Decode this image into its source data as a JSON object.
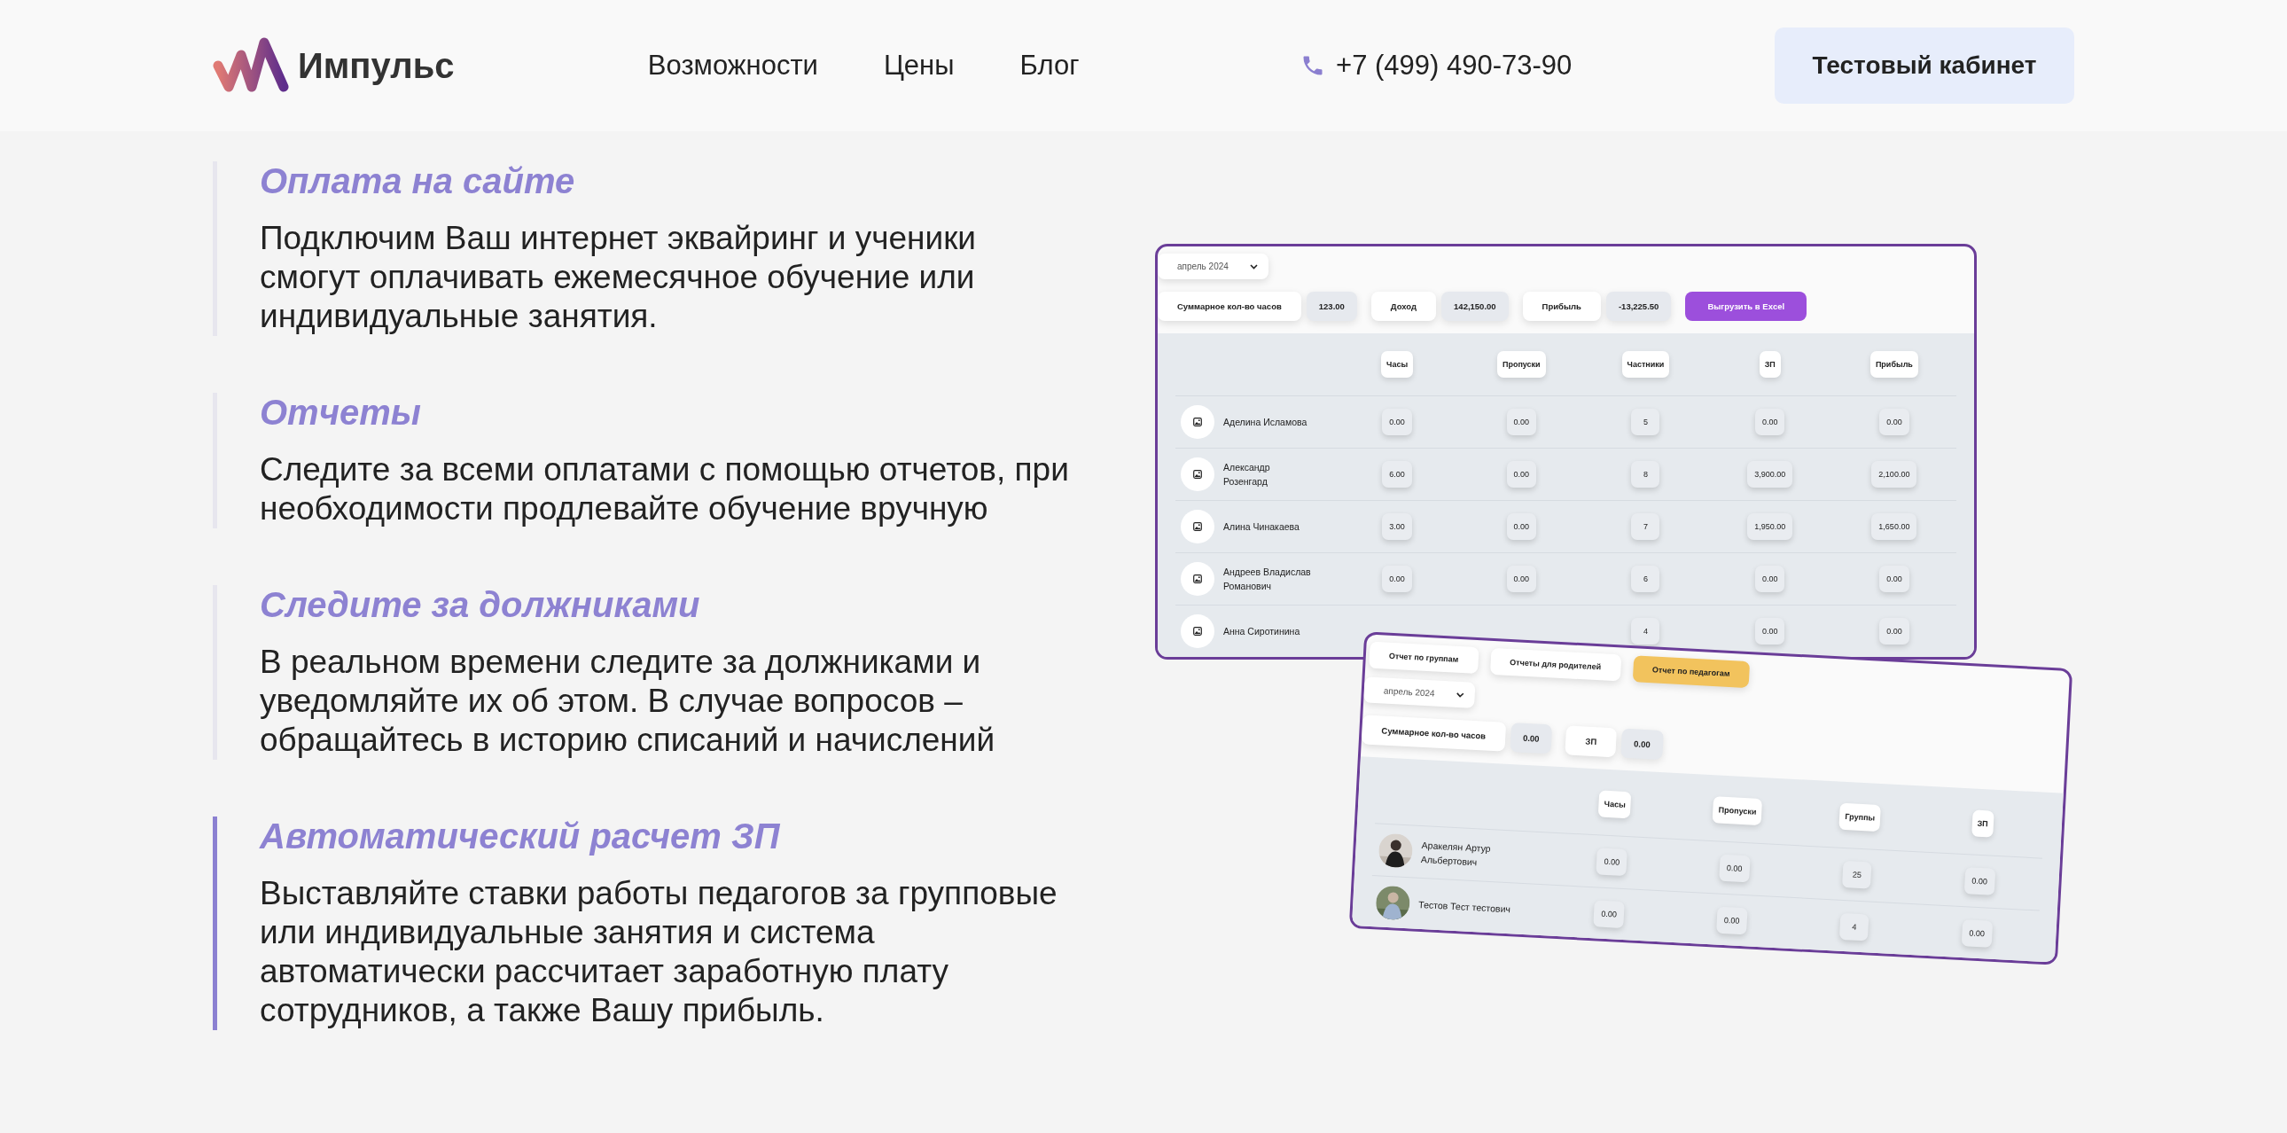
{
  "header": {
    "logo": "Импульс",
    "nav": [
      {
        "label": "Возможности"
      },
      {
        "label": "Цены"
      },
      {
        "label": "Блог"
      }
    ],
    "phone": "+7 (499) 490-73-90",
    "cabinet_button": "Тестовый кабинет"
  },
  "features": [
    {
      "title": "Оплата на сайте",
      "text": "Подключим Ваш интернет эквайринг и ученики смогут оплачивать ежемесячное обучение или индивидуальные занятия.",
      "selected": false
    },
    {
      "title": "Отчеты",
      "text": "Следите за всеми оплатами с помощью отчетов, при необходимости продлевайте обучение вручную",
      "selected": false
    },
    {
      "title": "Следите за должниками",
      "text": "В реальном времени следите за должниками и уведомляйте их об этом. В случае вопросов – обращайтесь в историю списаний и начислений",
      "selected": false
    },
    {
      "title": "Автоматический расчет ЗП",
      "text": "Выставляйте ставки работы педагогов за групповые или индивидуальные занятия и система автоматически рассчитает заработную плату сотрудников, а также Вашу прибыль.",
      "selected": true
    }
  ],
  "report_window": {
    "month": "апрель 2024",
    "stats": [
      {
        "label": "Суммарное кол-во часов",
        "value": "123.00"
      },
      {
        "label": "Доход",
        "value": "142,150.00"
      },
      {
        "label": "Прибыль",
        "value": "-13,225.50"
      }
    ],
    "export_button": "Выгрузить в Excel",
    "columns": [
      "Часы",
      "Пропуски",
      "Частники",
      "ЗП",
      "Прибыль"
    ],
    "rows": [
      {
        "name": "Аделина Исламова",
        "values": [
          "0.00",
          "0.00",
          "5",
          "0.00",
          "0.00"
        ]
      },
      {
        "name": "Александр Розенгард",
        "values": [
          "6.00",
          "0.00",
          "8",
          "3,900.00",
          "2,100.00"
        ]
      },
      {
        "name": "Алина Чинакаева",
        "values": [
          "3.00",
          "0.00",
          "7",
          "1,950.00",
          "1,650.00"
        ]
      },
      {
        "name": "Андреев Владислав Романович",
        "values": [
          "0.00",
          "0.00",
          "6",
          "0.00",
          "0.00"
        ]
      },
      {
        "name": "Анна Сиротинина",
        "values": [
          "4",
          "0.00",
          "0.00"
        ]
      }
    ]
  },
  "teacher_window": {
    "tabs": [
      {
        "label": "Отчет по группам",
        "selected": false
      },
      {
        "label": "Отчеты для родителей",
        "selected": false
      },
      {
        "label": "Отчет по педагогам",
        "selected": true
      }
    ],
    "month": "апрель 2024",
    "stats": [
      {
        "label": "Суммарное кол-во часов",
        "value": "0.00"
      },
      {
        "label": "ЗП",
        "value": "0.00"
      }
    ],
    "columns": [
      "Часы",
      "Пропуски",
      "Группы",
      "ЗП"
    ],
    "rows": [
      {
        "name": "Аракелян Артур Альбертович",
        "values": [
          "0.00",
          "0.00",
          "25",
          "0.00"
        ]
      },
      {
        "name": "Тестов Тест тестович",
        "values": [
          "0.00",
          "0.00",
          "4",
          "0.00"
        ]
      }
    ]
  }
}
